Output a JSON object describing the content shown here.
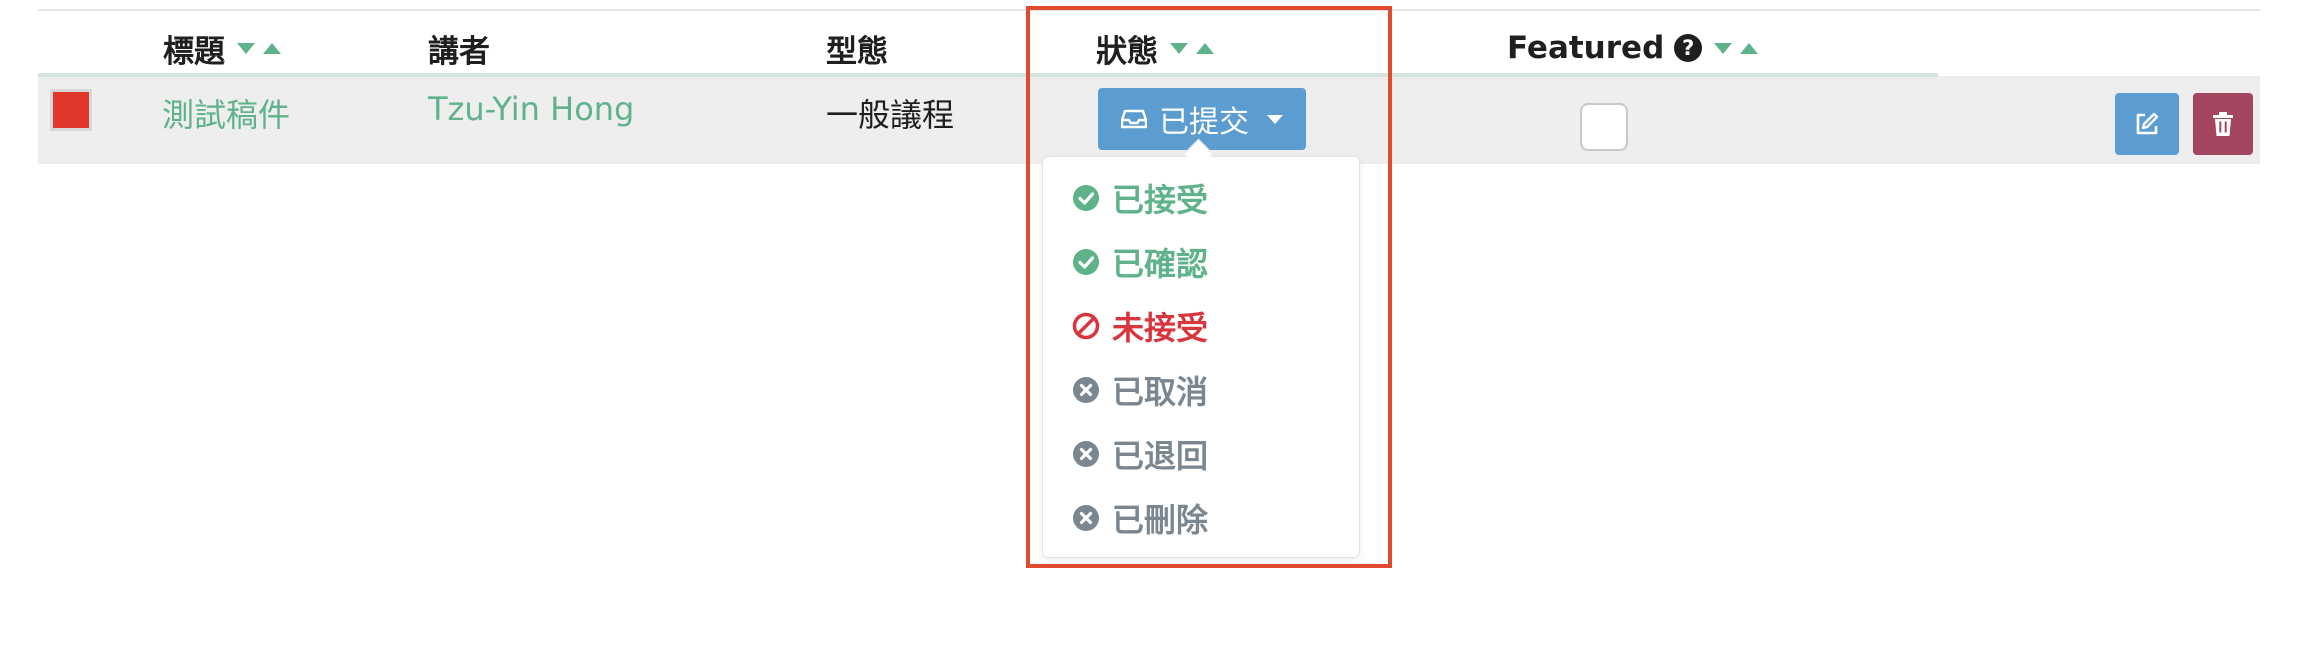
{
  "table": {
    "headers": {
      "title": "標題",
      "speaker": "講者",
      "type": "型態",
      "status": "狀態",
      "featured": "Featured",
      "help_icon_glyph": "?"
    },
    "rows": [
      {
        "color": "#e0362c",
        "title": "測試稿件",
        "speaker": "Tzu-Yin Hong",
        "type": "一般議程",
        "status": "已提交",
        "featured": false
      }
    ]
  },
  "status_dropdown": {
    "button_icon": "inbox-icon",
    "items": [
      {
        "label": "已接受",
        "icon": "check-circle-icon",
        "color": "#5fb38a"
      },
      {
        "label": "已確認",
        "icon": "check-circle-icon",
        "color": "#5fb38a"
      },
      {
        "label": "未接受",
        "icon": "ban-icon",
        "color": "#d8363c"
      },
      {
        "label": "已取消",
        "icon": "x-circle-icon",
        "color": "#7a8791"
      },
      {
        "label": "已退回",
        "icon": "x-circle-icon",
        "color": "#7a8791"
      },
      {
        "label": "已刪除",
        "icon": "x-circle-icon",
        "color": "#7a8791"
      }
    ]
  },
  "actions": {
    "edit_icon": "edit-icon",
    "delete_icon": "trash-icon"
  },
  "colors": {
    "accent_green": "#5fb38a",
    "primary_blue": "#5b9dd1",
    "danger": "#a54660",
    "highlight_border": "#e04a2f"
  }
}
